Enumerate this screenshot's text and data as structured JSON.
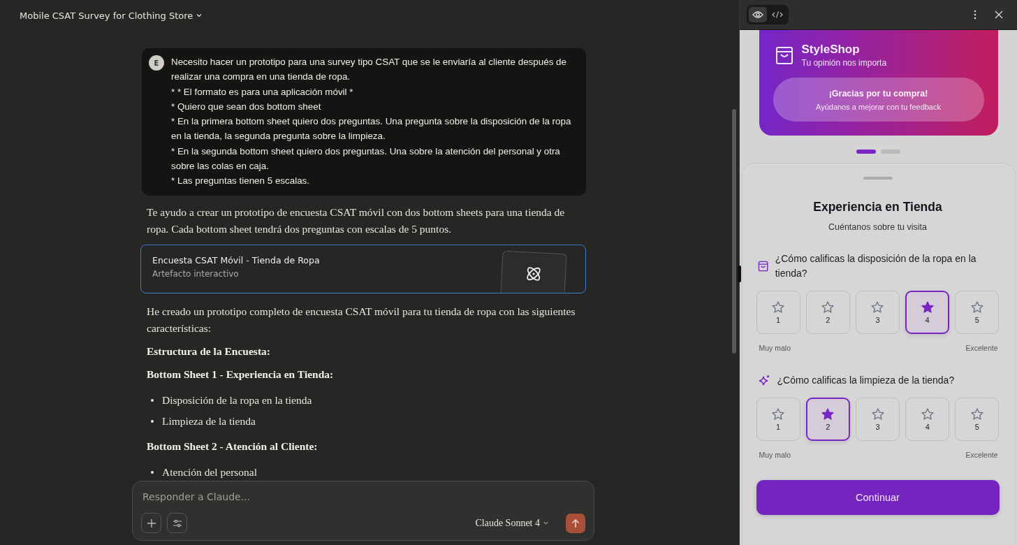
{
  "chat": {
    "title": "Mobile CSAT Survey for Clothing Store",
    "user_message": {
      "avatar": "E",
      "lines": [
        "Necesito hacer un prototipo para una survey tipo CSAT que se le enviaría al cliente después de realizar una compra en una tienda de ropa.",
        "* * El formato es para una aplicación móvil *",
        "* Quiero que sean dos bottom sheet",
        "* En la primera bottom sheet quiero dos preguntas. Una pregunta sobre la disposición de la ropa en la tienda, la segunda pregunta sobre la limpieza.",
        "* En la segunda bottom sheet quiero dos preguntas. Una sobre la atención del personal y otra sobre las colas en caja.",
        "* Las preguntas tienen 5 escalas."
      ]
    },
    "reply": [
      {
        "kind": "paragraph",
        "text": "Te ayudo a crear un prototipo de encuesta CSAT móvil con dos bottom sheets para una tienda de ropa. Cada bottom sheet tendrá dos preguntas con escalas de 5 puntos."
      },
      {
        "kind": "artifact",
        "title": "Encuesta CSAT Móvil - Tienda de Ropa",
        "subtitle": "Artefacto interactivo"
      },
      {
        "kind": "paragraph",
        "text": "He creado un prototipo completo de encuesta CSAT móvil para tu tienda de ropa con las siguientes características:"
      },
      {
        "kind": "heading",
        "text": "Estructura de la Encuesta:"
      },
      {
        "kind": "heading",
        "text": "Bottom Sheet 1 - Experiencia en Tienda:"
      },
      {
        "kind": "bullets",
        "items": [
          "Disposición de la ropa en la tienda",
          "Limpieza de la tienda"
        ]
      },
      {
        "kind": "heading",
        "text": "Bottom Sheet 2 - Atención al Cliente:"
      },
      {
        "kind": "bullets",
        "items": [
          "Atención del personal"
        ]
      }
    ],
    "composer": {
      "placeholder": "Responder a Claude...",
      "model": "Claude Sonnet 4"
    }
  },
  "preview": {
    "view_toggle": [
      {
        "kind": "preview",
        "selected": true
      },
      {
        "kind": "code",
        "selected": false
      }
    ],
    "hero": {
      "brand": "StyleShop",
      "tagline": "Tu opinión nos importa",
      "thanks": "¡Gracias por tu compra!",
      "thanks_sub": "Ayúdanos a mejorar con tu feedback"
    },
    "pager": [
      {
        "selected": true
      },
      {
        "selected": false
      }
    ],
    "sheet": {
      "title": "Experiencia en Tienda",
      "subtitle": "Cuéntanos sobre tu visita",
      "questions": [
        {
          "kind": "bag",
          "text": "¿Cómo calificas la disposición de la ropa en la tienda?",
          "options": [
            {
              "label": "1",
              "selected": false
            },
            {
              "label": "2",
              "selected": false
            },
            {
              "label": "3",
              "selected": false
            },
            {
              "label": "4",
              "selected": true
            },
            {
              "label": "5",
              "selected": false
            }
          ],
          "low": "Muy malo",
          "high": "Excelente"
        },
        {
          "kind": "sparkle",
          "text": "¿Cómo calificas la limpieza de la tienda?",
          "options": [
            {
              "label": "1",
              "selected": false
            },
            {
              "label": "2",
              "selected": true
            },
            {
              "label": "3",
              "selected": false
            },
            {
              "label": "4",
              "selected": false
            },
            {
              "label": "5",
              "selected": false
            }
          ],
          "low": "Muy malo",
          "high": "Excelente"
        }
      ],
      "button": "Continuar"
    }
  }
}
